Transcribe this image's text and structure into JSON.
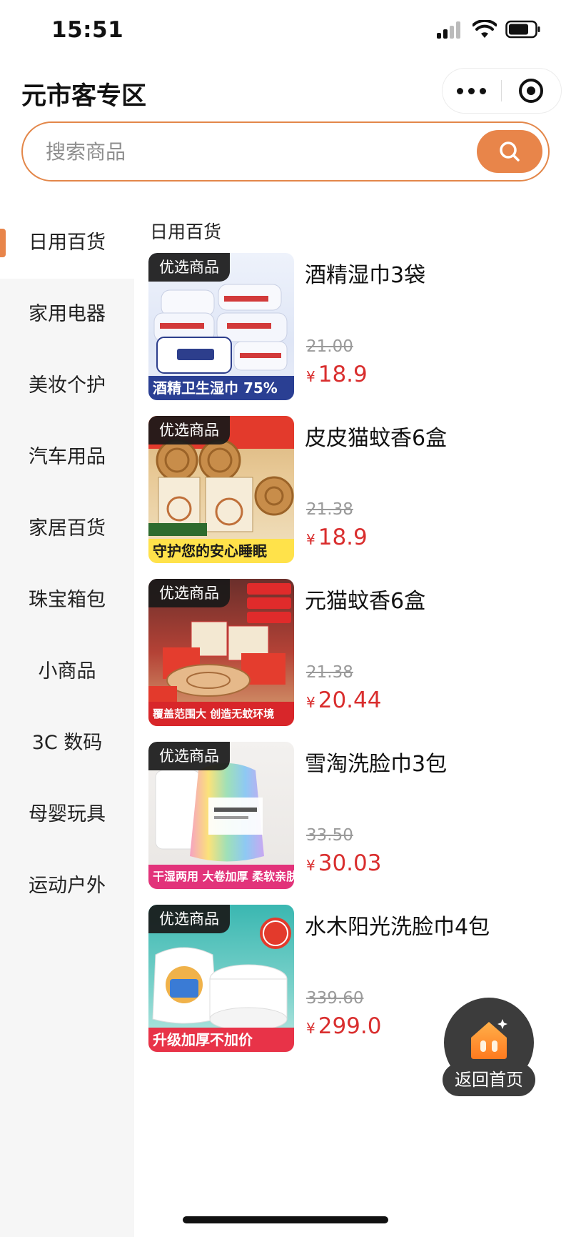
{
  "status_bar": {
    "time": "15:51"
  },
  "header": {
    "title": "元市客专区"
  },
  "search": {
    "placeholder": "搜索商品"
  },
  "sidebar": {
    "items": [
      {
        "label": "日用百货",
        "active": true
      },
      {
        "label": "家用电器"
      },
      {
        "label": "美妆个护"
      },
      {
        "label": "汽车用品"
      },
      {
        "label": "家居百货"
      },
      {
        "label": "珠宝箱包"
      },
      {
        "label": "小商品"
      },
      {
        "label": "3C 数码"
      },
      {
        "label": "母婴玩具"
      },
      {
        "label": "运动户外"
      }
    ]
  },
  "main": {
    "section_title": "日用百货",
    "products": [
      {
        "badge": "优选商品",
        "banner": "酒精卫生湿巾 75%",
        "name": "酒精湿巾3袋",
        "original_price": "21.00",
        "currency": "¥",
        "price": "18.9"
      },
      {
        "badge": "优选商品",
        "banner": "守护您的安心睡眠",
        "name": "皮皮猫蚊香6盒",
        "original_price": "21.38",
        "currency": "¥",
        "price": "18.9"
      },
      {
        "badge": "优选商品",
        "banner": "覆盖范围大 创造无蚊环境",
        "name": "元猫蚊香6盒",
        "original_price": "21.38",
        "currency": "¥",
        "price": "20.44"
      },
      {
        "badge": "优选商品",
        "banner": "干湿两用 大卷加厚 柔软亲肤",
        "name": "雪淘洗脸巾3包",
        "original_price": "33.50",
        "currency": "¥",
        "price": "30.03"
      },
      {
        "badge": "优选商品",
        "banner": "升级加厚不加价",
        "name": "水木阳光洗脸巾4包",
        "original_price": "339.60",
        "currency": "¥",
        "price": "299.0"
      }
    ]
  },
  "home_button": {
    "label": "返回首页"
  },
  "colors": {
    "accent": "#e8854a",
    "price": "#d92e2e",
    "sidebar_bg": "#f6f6f6"
  }
}
